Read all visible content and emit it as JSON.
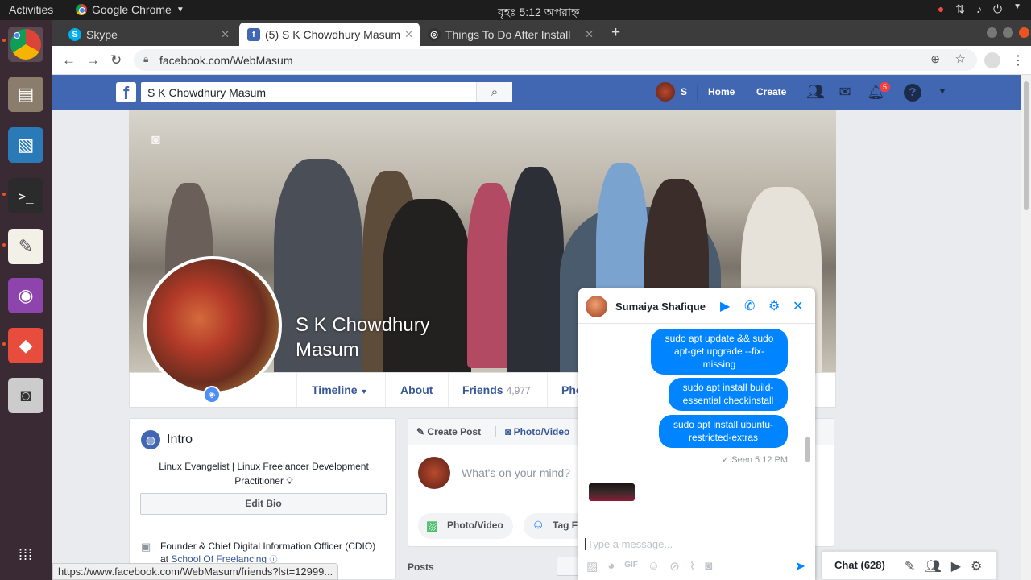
{
  "topbar": {
    "activities": "Activities",
    "app_name": "Google Chrome",
    "clock": "বৃহঃ   5:12 অপরাহ্ন"
  },
  "tabs": [
    {
      "label": "Skype",
      "favicon": "skype-icon",
      "color": "#00aff0"
    },
    {
      "label": "(5) S K Chowdhury Masum",
      "favicon": "facebook-icon",
      "color": "#4267b2"
    },
    {
      "label": "Things To Do After Install",
      "favicon": "github-icon",
      "color": "#333333"
    }
  ],
  "address": {
    "url": "facebook.com/WebMasum"
  },
  "fb_header": {
    "search_value": "S K Chowdhury Masum",
    "user_initial": "S",
    "home": "Home",
    "create": "Create",
    "notif_count": "5"
  },
  "profile": {
    "name_line1": "S K Chowdhury",
    "name_line2": "Masum",
    "nav": {
      "timeline": "Timeline",
      "about": "About",
      "friends": "Friends",
      "friends_count": "4,977",
      "photos": "Pho"
    }
  },
  "intro": {
    "title": "Intro",
    "bio": "Linux Evangelist | Linux Freelancer Development Practitioner",
    "edit_bio": "Edit Bio",
    "work_text": "Founder & Chief Digital Information Officer (CDIO) at",
    "work_link": "School Of Freelancing"
  },
  "create_post": {
    "create_post": "Create Post",
    "photo_video": "Photo/Video",
    "placeholder": "What's on your mind?",
    "pill_photo": "Photo/Video",
    "pill_tag": "Tag Fr"
  },
  "posts_label": "Posts",
  "chat": {
    "name": "Sumaiya Shafique",
    "messages": [
      "sudo apt update && sudo apt-get upgrade --fix-missing",
      "sudo apt install build-essential checkinstall",
      "sudo apt install ubuntu-restricted-extras"
    ],
    "seen": "✓ Seen 5:12 PM",
    "input_placeholder": "Type a message..."
  },
  "chatbar": {
    "label": "Chat (628)"
  },
  "status_url": "https://www.facebook.com/WebMasum/friends?lst=12999..."
}
